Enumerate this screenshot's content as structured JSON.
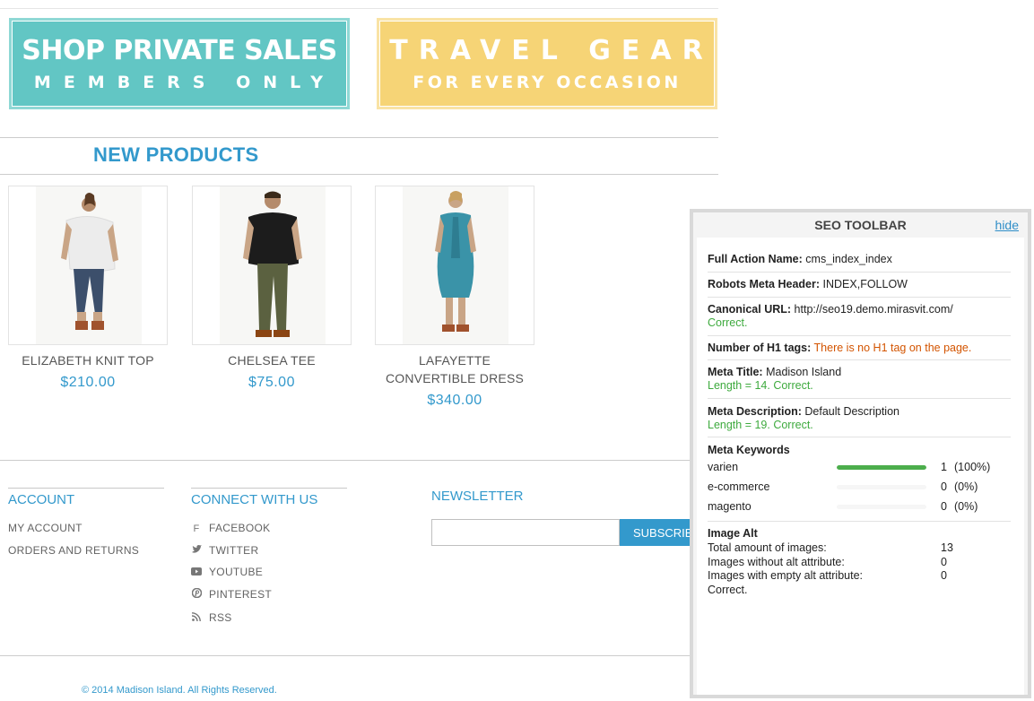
{
  "banners": {
    "private": {
      "line1": "SHOP PRIVATE SALES",
      "line2": "MEMBERS ONLY"
    },
    "travel": {
      "line1": "TRAVEL GEAR",
      "line2": "FOR EVERY OCCASION"
    }
  },
  "new_products": {
    "title": "NEW PRODUCTS",
    "items": [
      {
        "name": "ELIZABETH KNIT TOP",
        "price": "$210.00",
        "image_icon": "woman-white-top-photo"
      },
      {
        "name": "CHELSEA TEE",
        "price": "$75.00",
        "image_icon": "man-black-tee-photo"
      },
      {
        "name_line1": "LAFAYETTE",
        "name_line2": "CONVERTIBLE DRESS",
        "price": "$340.00",
        "image_icon": "woman-teal-dress-photo"
      }
    ]
  },
  "footer": {
    "account": {
      "heading": "ACCOUNT",
      "links": [
        "MY ACCOUNT",
        "ORDERS AND RETURNS"
      ]
    },
    "connect": {
      "heading": "CONNECT WITH US",
      "links": [
        "FACEBOOK",
        "TWITTER",
        "YOUTUBE",
        "PINTEREST",
        "RSS"
      ]
    },
    "newsletter": {
      "heading": "NEWSLETTER",
      "input_value": "",
      "button": "SUBSCRIBE"
    },
    "copyright": "© 2014 Madison Island. All Rights Reserved."
  },
  "seo_toolbar": {
    "title": "SEO TOOLBAR",
    "hide": "hide",
    "full_action_label": "Full Action Name:",
    "full_action_value": "cms_index_index",
    "robots_label": "Robots Meta Header:",
    "robots_value": "INDEX,FOLLOW",
    "canonical_label": "Canonical URL:",
    "canonical_value": "http://seo19.demo.mirasvit.com/",
    "canonical_status": "Correct.",
    "h1_label": "Number of H1 tags:",
    "h1_value": "There is no H1 tag on the page.",
    "meta_title_label": "Meta Title:",
    "meta_title_value": "Madison Island",
    "meta_title_status": "Length = 14. Correct.",
    "meta_desc_label": "Meta Description:",
    "meta_desc_value": "Default Description",
    "meta_desc_status": "Length = 19. Correct.",
    "keywords_label": "Meta Keywords",
    "keywords": [
      {
        "name": "varien",
        "count": "1",
        "pct": "(100%)",
        "fraction": 1.0
      },
      {
        "name": "e-commerce",
        "count": "0",
        "pct": "(0%)",
        "fraction": 0.0
      },
      {
        "name": "magento",
        "count": "0",
        "pct": "(0%)",
        "fraction": 0.0
      }
    ],
    "image_alt_label": "Image Alt",
    "total_images_label": "Total amount of images:",
    "total_images_value": "13",
    "without_alt_label": "Images without alt attribute:",
    "without_alt_value": "0",
    "empty_alt_label": "Images with empty alt attribute:",
    "empty_alt_value": "0",
    "image_alt_status": "Correct.",
    "colors": {
      "ok": "#3eaa3e",
      "warn": "#d35400",
      "bar": "#4cae4c"
    }
  }
}
